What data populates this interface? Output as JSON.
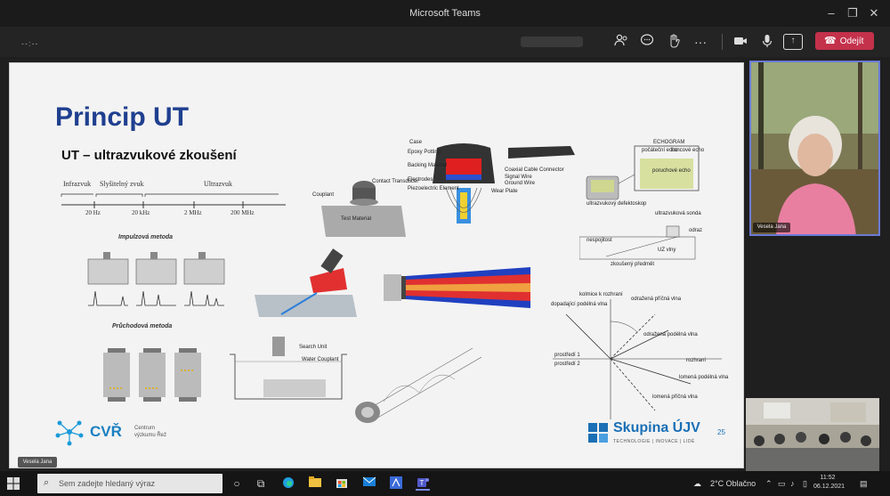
{
  "window": {
    "title": "Microsoft Teams"
  },
  "toolbar": {
    "meeting_time": "--:--",
    "leave_label": "Odejít"
  },
  "slide": {
    "title": "Princip UT",
    "subtitle": "UT – ultrazvukové zkoušení",
    "scale_labels": [
      "Infrazvuk",
      "Slyšitelný zvuk",
      "Ultrazvuk"
    ],
    "scale_ticks": [
      "20 Hz",
      "20 kHz",
      "2 MHz",
      "200 MHz"
    ],
    "impulse_label": "Impulzová metoda",
    "through_label": "Průchodová metoda",
    "transducer_labels": [
      "Couplant",
      "Contact Transducer",
      "Test Material"
    ],
    "probe_labels": [
      "Case",
      "Epoxy Potting",
      "Backing Material",
      "Electrodes",
      "Piezoelectric Element",
      "Coaxial Cable Connector",
      "Signal Wire",
      "Ground Wire",
      "Wear Plate"
    ],
    "echogram_labels": [
      "ECHOGRAM",
      "počáteční echo",
      "koncové echo",
      "poruchové echo",
      "ultrazvukový defektoskop",
      "ultrazvuková sonda",
      "nespojitost",
      "zkoušený předmět",
      "UZ vlny",
      "odraz"
    ],
    "wave_labels": [
      "kolmice k rozhraní",
      "dopadající podélná vlna",
      "odražená příčná vlna",
      "odražená podélná vlna",
      "prostředí 1",
      "prostředí 2",
      "rozhraní",
      "lomená podélná vlna",
      "lomená příčná vlna"
    ],
    "water_labels": [
      "Search Unit",
      "Water Couplant"
    ],
    "cvr_name": "CVŘ",
    "cvr_sub": [
      "Centrum",
      "výzkumu Řež"
    ],
    "ujv_name": "Skupina ÚJV",
    "ujv_tag": "TECHNOLOGIE | INOVACE | LIDÉ",
    "page_number": "25",
    "presenter_tag": "Vesela Jana"
  },
  "participants": [
    {
      "name": "Vesela Jana"
    }
  ],
  "taskbar": {
    "search_placeholder": "Sem zadejte hledaný výraz",
    "weather": "2°C  Oblačno",
    "time": "11:52",
    "date": "06.12.2021"
  },
  "colors": {
    "accent": "#6b7ad6",
    "leave": "#c4314b",
    "slide_title": "#1f3f8f",
    "ujv_blue": "#1a6fb5"
  }
}
